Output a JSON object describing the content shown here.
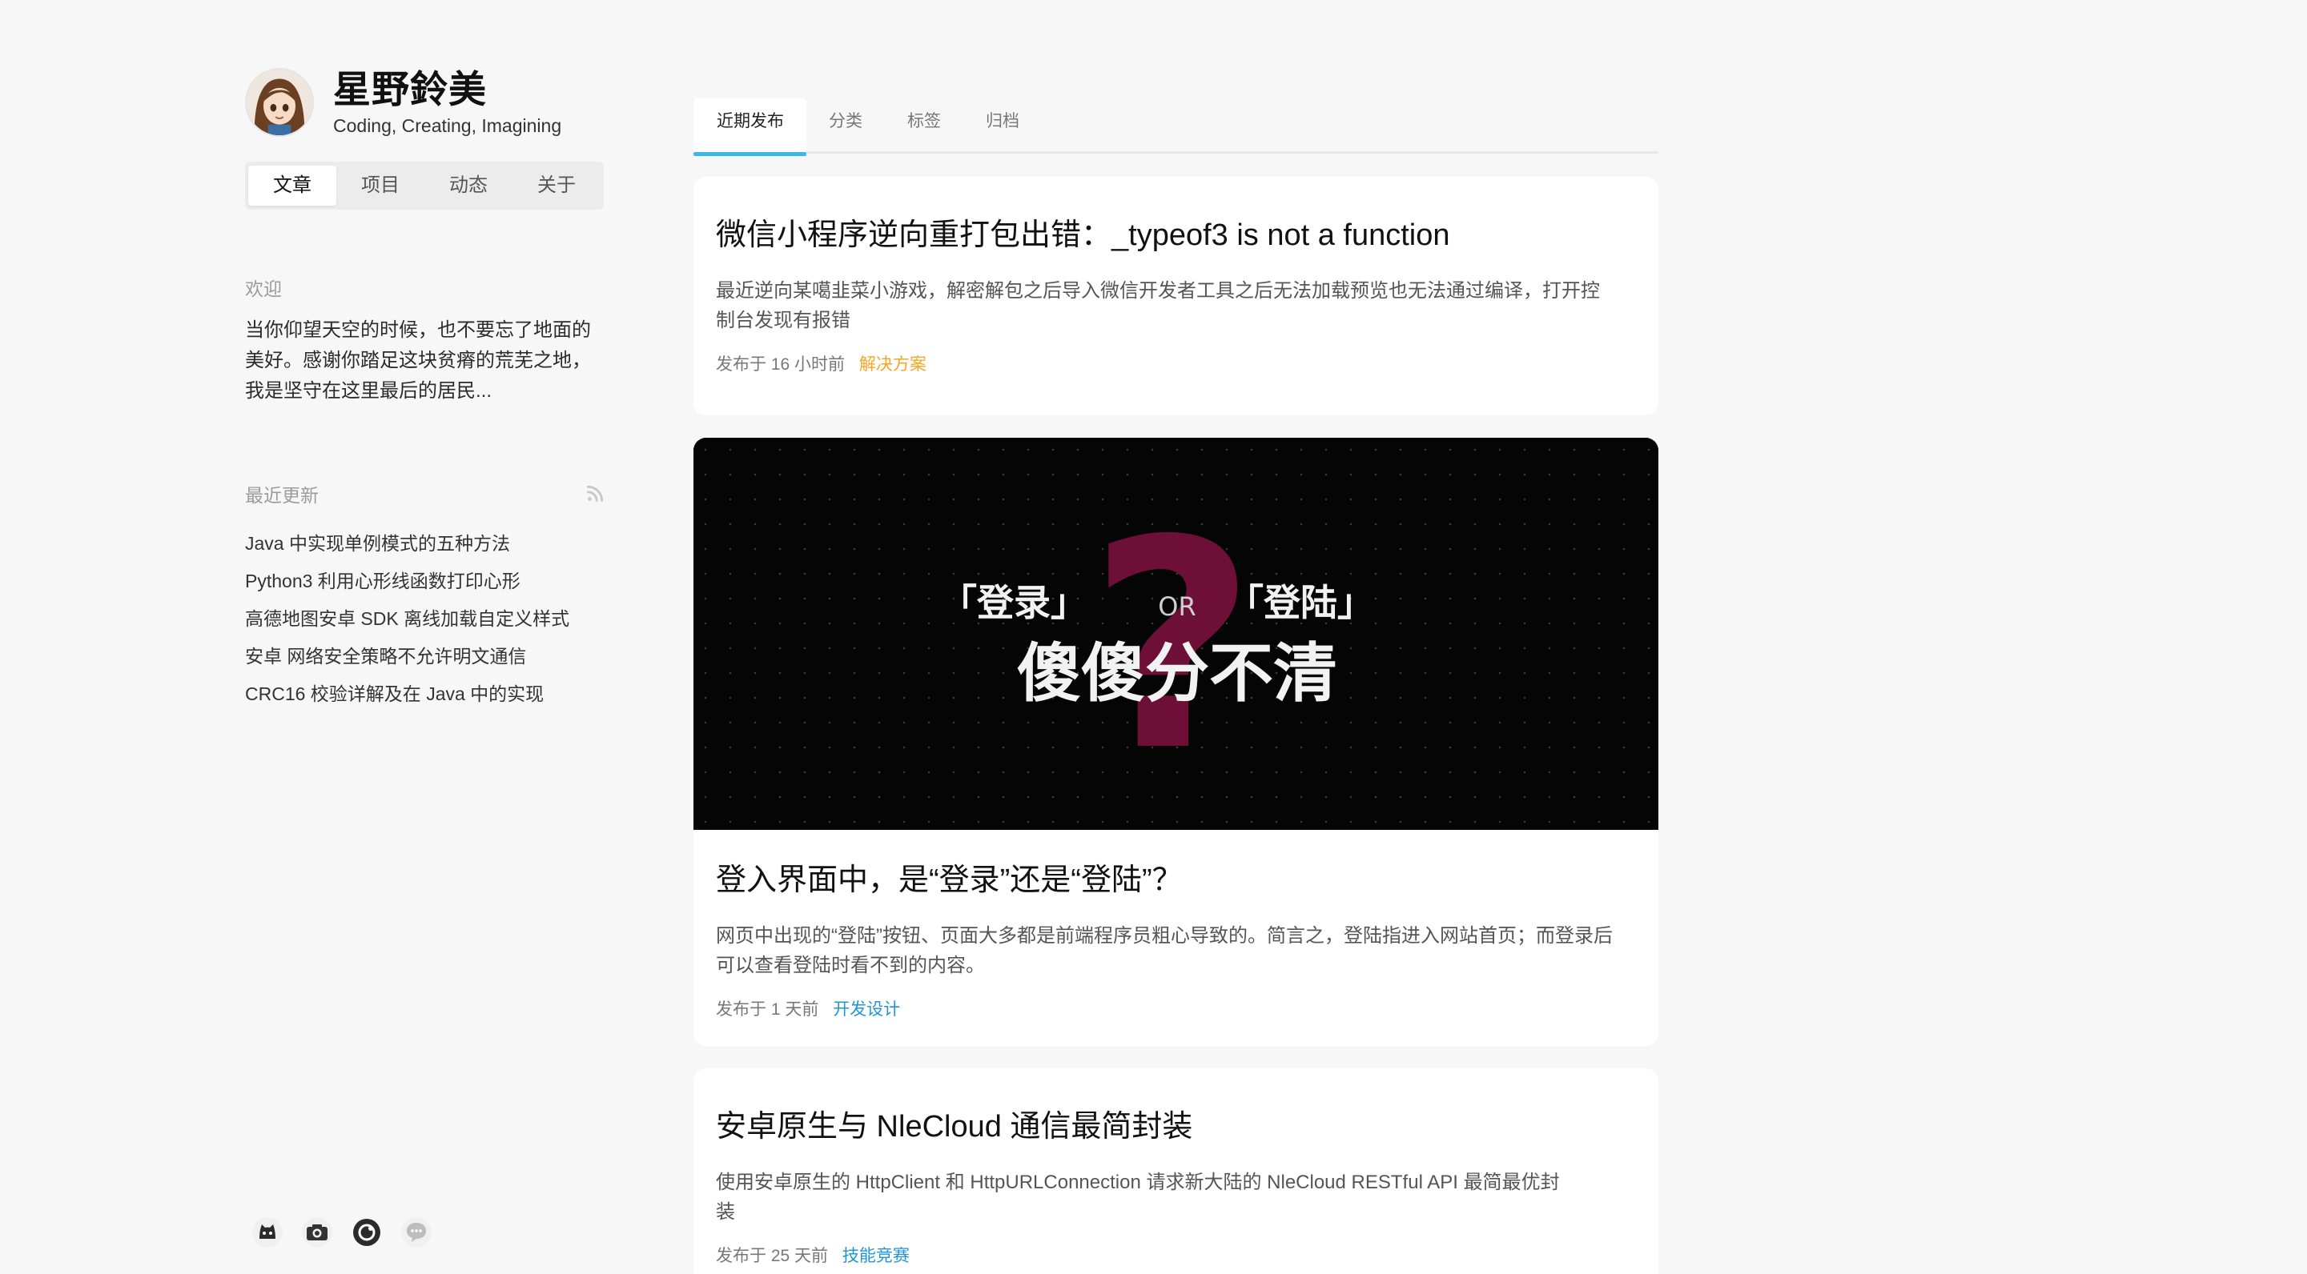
{
  "profile": {
    "name": "星野鈴美",
    "motto": "Coding, Creating, Imagining"
  },
  "nav": [
    {
      "label": "文章",
      "active": true
    },
    {
      "label": "项目",
      "active": false
    },
    {
      "label": "动态",
      "active": false
    },
    {
      "label": "关于",
      "active": false
    }
  ],
  "welcome": {
    "title": "欢迎",
    "lines": [
      "当你仰望天空的时候，也不要忘了地面的",
      "美好。感谢你踏足这块贫瘠的荒芜之地，",
      "我是坚守在这里最后的居民..."
    ]
  },
  "recent": {
    "title": "最近更新",
    "rss_icon": "rss-icon",
    "items": [
      "Java 中实现单例模式的五种方法",
      "Python3 利用心形线函数打印心形",
      "高德地图安卓 SDK 离线加载自定义样式",
      "安卓 网络安全策略不允许明文通信",
      "CRC16 校验详解及在 Java 中的实现"
    ]
  },
  "socials": [
    "github-icon",
    "camera-icon",
    "circle-logo-icon",
    "chat-icon"
  ],
  "tabs": [
    {
      "label": "近期发布",
      "active": true
    },
    {
      "label": "分类",
      "active": false
    },
    {
      "label": "标签",
      "active": false
    },
    {
      "label": "归档",
      "active": false
    }
  ],
  "posts": [
    {
      "title": "微信小程序逆向重打包出错：_typeof3 is not a function",
      "excerpt_lines": [
        "最近逆向某噶韭菜小游戏，解密解包之后导入微信开发者工具之后无法加载预览也无法通过编译，打开控",
        "制台发现有报错"
      ],
      "meta": "发布于 16 小时前",
      "tag": "解决方案",
      "tag_color": "#f5a623"
    },
    {
      "cover": {
        "line1_left": "「登录」",
        "line1_mid": "OR",
        "line1_right": "「登陆」",
        "line2": "傻傻分不清",
        "mark": "?",
        "mark_color": "#6d0f36"
      },
      "title": "登入界面中，是“登录”还是“登陆”？",
      "excerpt_lines": [
        "网页中出现的“登陆”按钮、页面大多都是前端程序员粗心导致的。简言之，登陆指进入网站首页；而登录后",
        "可以查看登陆时看不到的内容。"
      ],
      "meta": "发布于 1 天前",
      "tag": "开发设计",
      "tag_color": "#2196d3"
    },
    {
      "title": "安卓原生与 NleCloud 通信最简封装",
      "excerpt_lines": [
        "使用安卓原生的 HttpClient 和 HttpURLConnection 请求新大陆的 NleCloud RESTful API 最简最优封",
        "装"
      ],
      "meta": "发布于 25 天前",
      "tag": "技能竞赛",
      "tag_color": "#2196d3"
    }
  ],
  "colors": {
    "accent": "#3ab8e6",
    "background": "#f7f7f7"
  }
}
